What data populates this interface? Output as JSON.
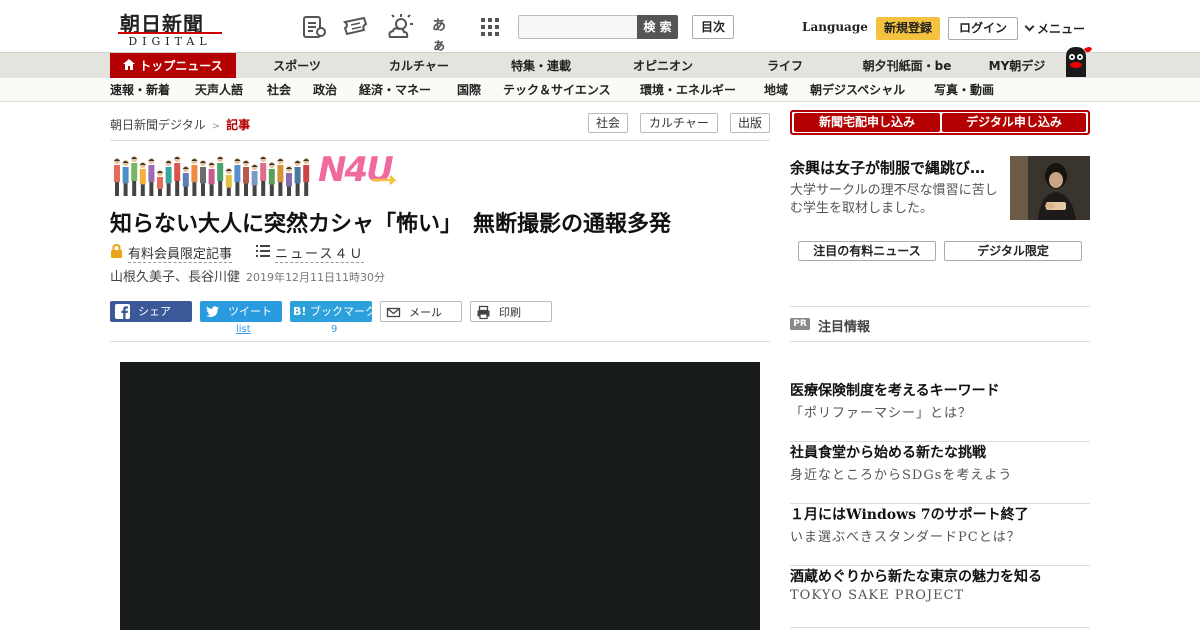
{
  "header": {
    "logo_main": "朝日新聞",
    "logo_sub": "DIGITAL",
    "icons": [
      "newspaper-icon",
      "ticket-icon",
      "weather-icon",
      "font-size-icon",
      "grid-menu-icon"
    ],
    "font_icon_text": "あぁ",
    "search_placeholder": "",
    "search_button": "検 索",
    "contents_button": "目次",
    "language": "Language",
    "register": "新規登録",
    "login": "ログイン",
    "menu": "メニュー"
  },
  "nav_primary": [
    "トップニュース",
    "スポーツ",
    "カルチャー",
    "特集・連載",
    "オピニオン",
    "ライフ",
    "朝夕刊紙面・be",
    "MY朝デジ"
  ],
  "nav_secondary": [
    "速報・新着",
    "天声人語",
    "社会",
    "政治",
    "経済・マネー",
    "国際",
    "テック＆サイエンス",
    "環境・エネルギー",
    "地域",
    "朝デジスペシャル",
    "写真・動画"
  ],
  "breadcrumb": {
    "home": "朝日新聞デジタル",
    "separator": ">",
    "current": "記事"
  },
  "tags": [
    "社会",
    "カルチャー",
    "出版"
  ],
  "article": {
    "banner_label": "N4U",
    "headline": "知らない大人に突然カシャ「怖い」　無断撮影の通報多発",
    "paid_label": "有料会員限定記事",
    "series": "ニュース４Ｕ",
    "authors": "山根久美子、長谷川健",
    "date": "2019年12月11日11時30分"
  },
  "share": {
    "facebook": "シェア",
    "twitter": "ツイート",
    "hatena": "ブックマーク",
    "hatena_badge": "B!",
    "mail": "メール",
    "print": "印刷",
    "twitter_count": "list",
    "hatena_count": "9"
  },
  "sidebar": {
    "subscribe_paper": "新聞宅配申し込み",
    "subscribe_digital": "デジタル申し込み",
    "feature_title": "余興は女子が制服で縄跳び…",
    "feature_desc": "大学サークルの理不尽な慣習に苦しむ学生を取材しました。",
    "btn_paid_news": "注目の有料ニュース",
    "btn_digital_only": "デジタル限定",
    "pr_badge": "PR",
    "pr_label": "注目情報",
    "pr_items": [
      {
        "title": "医療保険制度を考えるキーワード",
        "sub": "「ポリファーマシー」とは？"
      },
      {
        "title": "社員食堂から始める新たな挑戦",
        "sub": "身近なところからSDGsを考えよう"
      },
      {
        "title": "１月にはWindows 7のサポート終了",
        "sub": "いま選ぶべきスタンダードPCとは？"
      },
      {
        "title": "酒蔵めぐりから新たな東京の魅力を知る",
        "sub": "TOKYO SAKE PROJECT"
      }
    ]
  },
  "colors": {
    "brand_red": "#b40000",
    "register_yellow": "#f4c23f",
    "facebook_blue": "#3b5998",
    "twitter_blue": "#2b9be0",
    "n4u_pink": "#f06aa0"
  }
}
